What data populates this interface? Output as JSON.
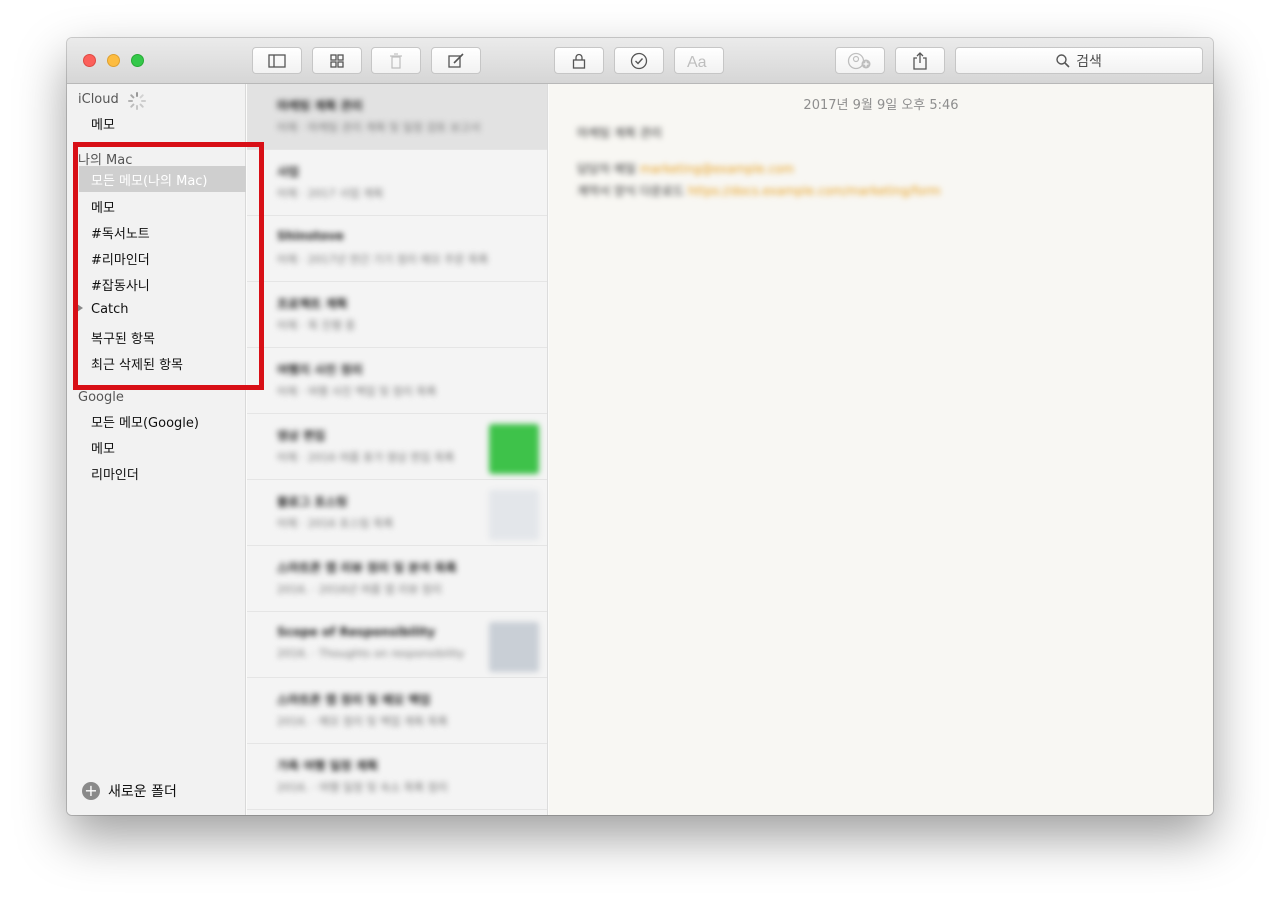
{
  "toolbar": {
    "search_label": "검색",
    "buttons": [
      "sidebar-toggle",
      "gallery-view",
      "delete",
      "compose",
      "lock",
      "checklist",
      "format",
      "collaborate",
      "share"
    ]
  },
  "sidebar": {
    "icloud": {
      "title": "iCloud",
      "items": [
        "메모"
      ]
    },
    "mymac": {
      "title": "나의 Mac",
      "items": [
        "모든 메모(나의 Mac)",
        "메모",
        "#독서노트",
        "#리마인더",
        "#잡동사니",
        "Catch",
        "복구된 항목",
        "최근 삭제된 항목"
      ],
      "selected_index": 0
    },
    "google": {
      "title": "Google",
      "items": [
        "모든 메모(Google)",
        "메모",
        "리마인더"
      ]
    },
    "new_folder_label": "새로운 폴더"
  },
  "note_list": [
    {
      "title": "마케팅 계획 관리",
      "snippet": "어제 · 마케팅 관리 계획 및 일정 검토 보고서"
    },
    {
      "title": "사업",
      "snippet": "어제 · 2017 사업 계획"
    },
    {
      "title": "Shinstove",
      "snippet": "어제 · 2017년 연간 기기 정리 메모 주문 목록"
    },
    {
      "title": "프로젝트 계획",
      "snippet": "어제 · 목 진행 중"
    },
    {
      "title": "여행지 사진 정리",
      "snippet": "어제 · 여행 사진 백업 및 정리 목록"
    },
    {
      "title": "영상 편집",
      "snippet": "어제 · 2016 여름 휴가 영상 편집 목록"
    },
    {
      "title": "블로그 포스팅",
      "snippet": "어제 · 2016 포스팅 목록"
    },
    {
      "title": "스마트폰 앱 리뷰 정리 및 분석 목록",
      "snippet": "2016. · 2016년 여름 앱 리뷰 정리"
    },
    {
      "title": "Scope of Responsibility",
      "snippet": "2016. · Thoughts on responsibility"
    },
    {
      "title": "스마트폰 앱 정리 및 메모 백업",
      "snippet": "2016. · 메모 정리 및 백업 계획 목록"
    },
    {
      "title": "가족 여행 일정 계획",
      "snippet": "2016. · 여행 일정 및 숙소 목록 정리"
    }
  ],
  "editor": {
    "date": "2017년 9월 9일 오후 5:46",
    "lines": [
      {
        "text": "마케팅 계획 관리",
        "link": ""
      },
      {
        "text": "담당자 메일 ",
        "link": "marketing@example.com"
      },
      {
        "text": "계약서 양식 다운로드 ",
        "link": "https://docs.example.com/marketing/form"
      }
    ]
  },
  "colors": {
    "highlight_box": "#d80f16",
    "selected_row": "#cfcfcf",
    "link": "#e7a020"
  }
}
